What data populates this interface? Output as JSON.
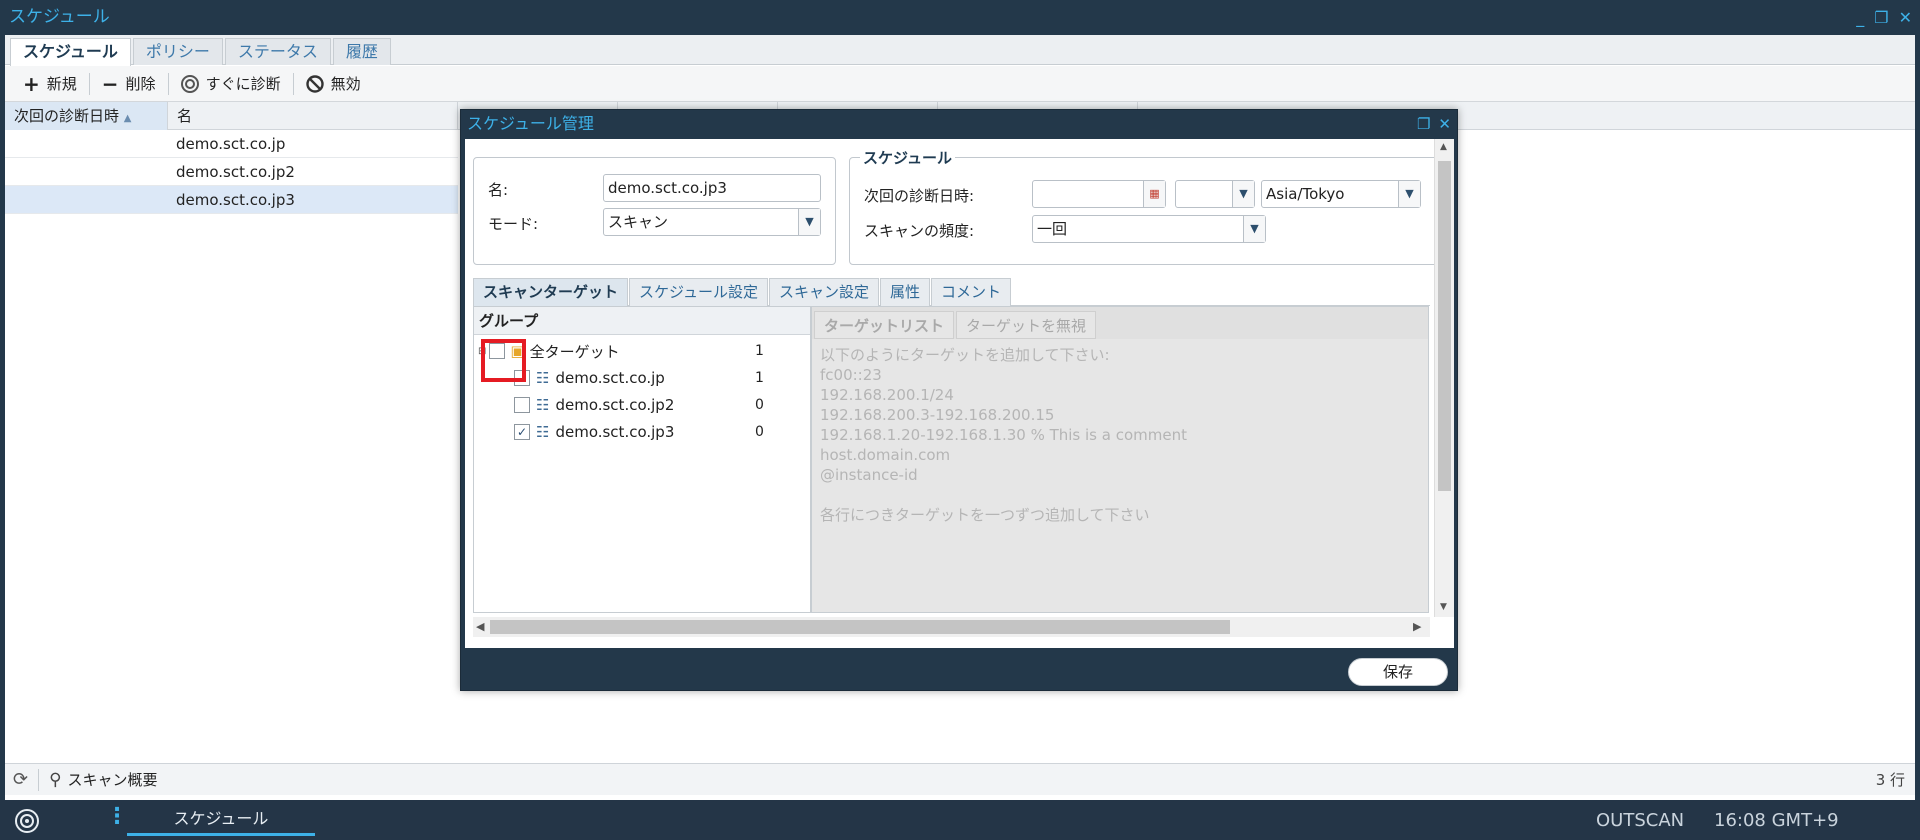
{
  "window": {
    "title": "スケジュール"
  },
  "tabs": [
    {
      "label": "スケジュール"
    },
    {
      "label": "ポリシー"
    },
    {
      "label": "ステータス"
    },
    {
      "label": "履歴"
    }
  ],
  "toolbar": {
    "new": "新規",
    "delete": "削除",
    "scan_now": "すぐに診断",
    "disable": "無効"
  },
  "grid": {
    "columns": [
      "次回の診断日時",
      "名"
    ],
    "rows": [
      {
        "name": "demo.sct.co.jp"
      },
      {
        "name": "demo.sct.co.jp2"
      },
      {
        "name": "demo.sct.co.jp3",
        "selected": true
      }
    ]
  },
  "statusbar": {
    "label": "スキャン概要",
    "count": "3 行"
  },
  "taskbar": {
    "item": "スケジュール",
    "brand": "OUTSCAN",
    "clock": "16:08 GMT+9"
  },
  "dialog": {
    "title": "スケジュール管理",
    "name_label": "名:",
    "name_value": "demo.sct.co.jp3",
    "mode_label": "モード:",
    "mode_value": "スキャン",
    "schedule_legend": "スケジュール",
    "next_scan_label": "次回の診断日時:",
    "timezone": "Asia/Tokyo",
    "frequency_label": "スキャンの頻度:",
    "frequency_value": "一回",
    "tabs": [
      "スキャンターゲット",
      "スケジュール設定",
      "スキャン設定",
      "属性",
      "コメント"
    ],
    "group_header": "グループ",
    "tree": [
      {
        "label": "全ターゲット",
        "count": "1",
        "checked": false
      },
      {
        "label": "demo.sct.co.jp",
        "count": "1",
        "checked": false
      },
      {
        "label": "demo.sct.co.jp2",
        "count": "0",
        "checked": false
      },
      {
        "label": "demo.sct.co.jp3",
        "count": "0",
        "checked": true
      }
    ],
    "target_tabs": [
      "ターゲットリスト",
      "ターゲットを無視"
    ],
    "target_help": "以下のようにターゲットを追加して下さい:\nfc00::23\n192.168.200.1/24\n192.168.200.3-192.168.200.15\n192.168.1.20-192.168.1.30 % This is a comment\nhost.domain.com\n@instance-id\n\n各行につきターゲットを一つずつ追加して下さい",
    "save": "保存"
  },
  "colors": {
    "accent": "#3db1e8",
    "chrome": "#23384a",
    "highlight": "#e51b23"
  }
}
